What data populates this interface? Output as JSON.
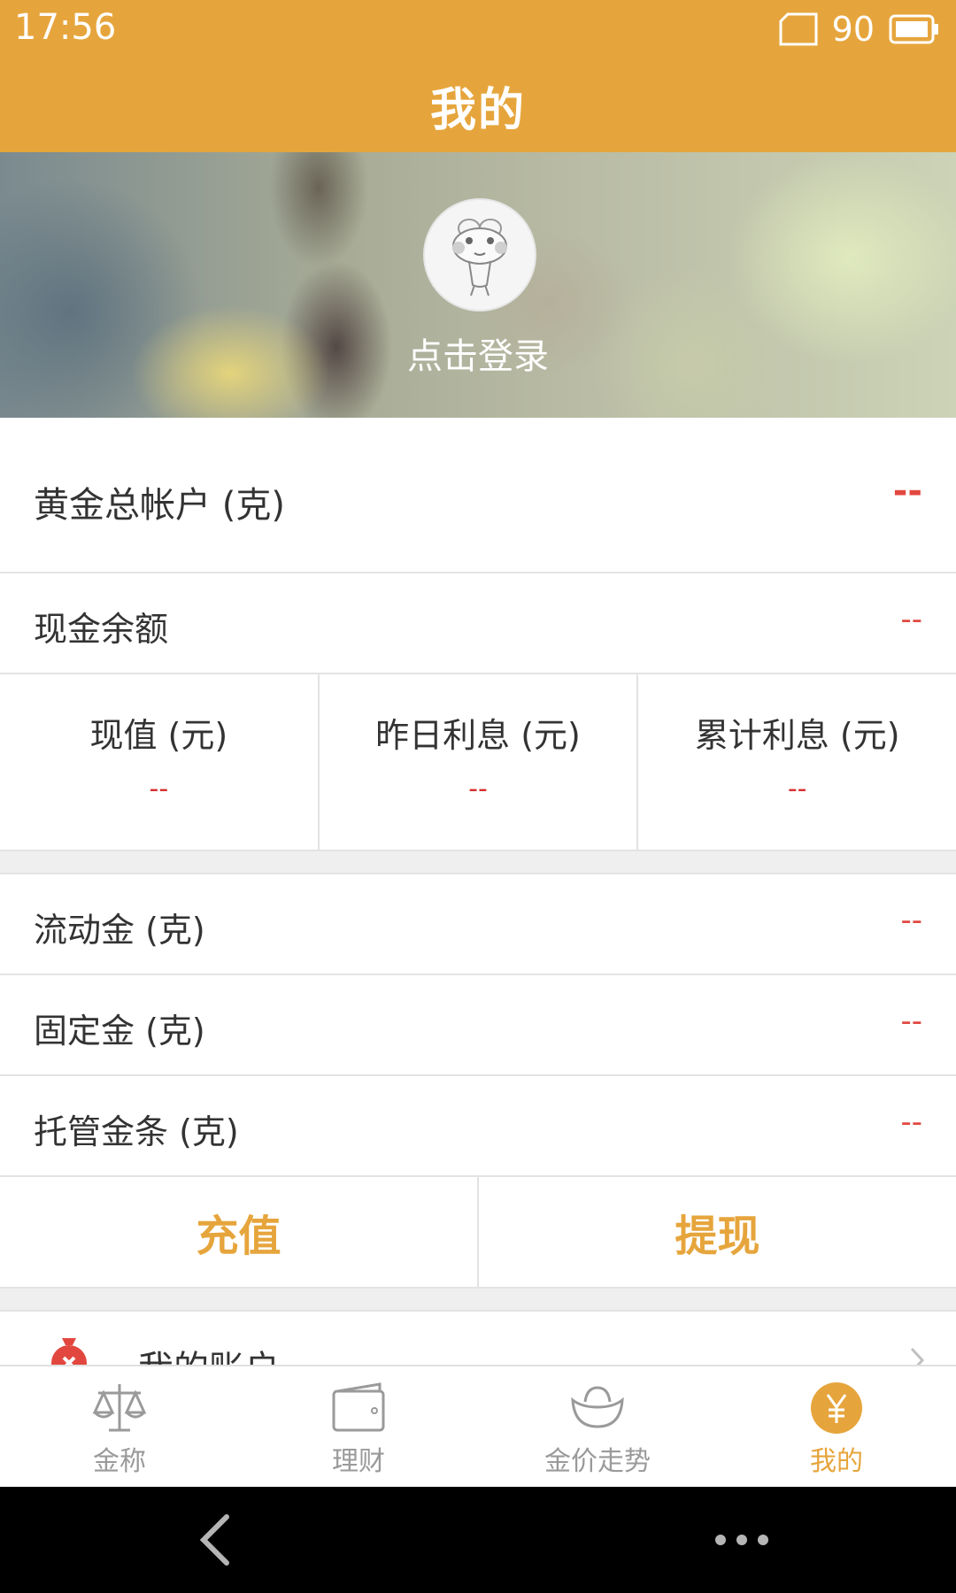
{
  "status_bar": {
    "time": "17:56",
    "battery": "90"
  },
  "header": {
    "title": "我的"
  },
  "profile": {
    "login_prompt": "点击登录"
  },
  "gold_total": {
    "label": "黄金总帐户 (克)",
    "value": "--"
  },
  "cash_balance": {
    "label": "现金余额",
    "value": "--"
  },
  "stats": [
    {
      "label": "现值 (元)",
      "value": "--"
    },
    {
      "label": "昨日利息 (元)",
      "value": "--"
    },
    {
      "label": "累计利息 (元)",
      "value": "--"
    }
  ],
  "holdings": [
    {
      "label": "流动金 (克)",
      "value": "--"
    },
    {
      "label": "固定金 (克)",
      "value": "--"
    },
    {
      "label": "托管金条 (克)",
      "value": "--"
    }
  ],
  "actions": {
    "recharge": "充值",
    "withdraw": "提现"
  },
  "menu": {
    "account_label": "我的账户"
  },
  "tabs": [
    {
      "label": "金称",
      "icon": "scale-icon"
    },
    {
      "label": "理财",
      "icon": "wallet-icon"
    },
    {
      "label": "金价走势",
      "icon": "gold-ingot-icon"
    },
    {
      "label": "我的",
      "icon": "yen-icon",
      "active": true
    }
  ],
  "colors": {
    "accent": "#e6a53c",
    "value_red": "#e2473f",
    "divider": "#e3e3e3"
  }
}
